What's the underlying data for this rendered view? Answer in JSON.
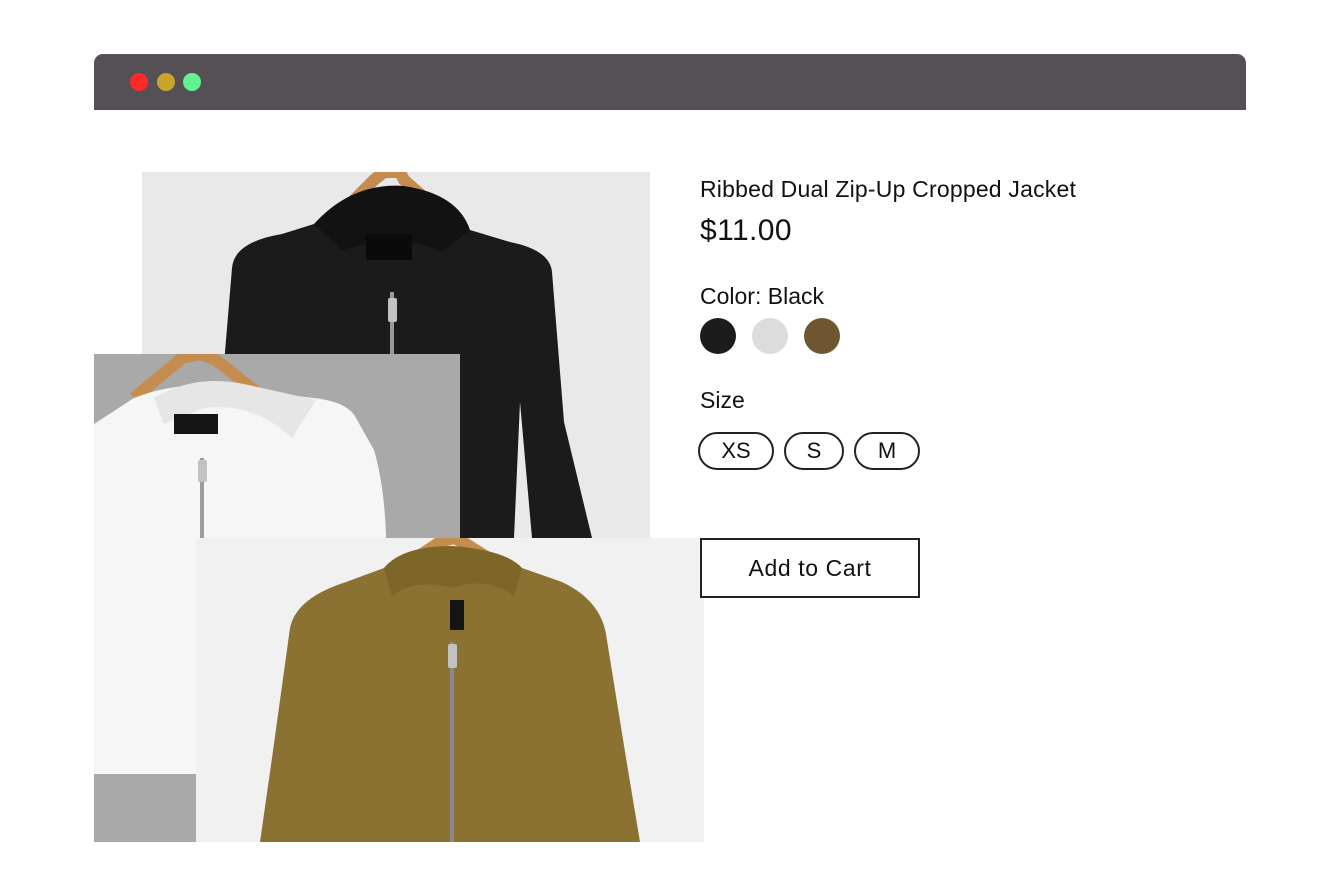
{
  "window": {
    "controls": [
      "close",
      "minimize",
      "maximize"
    ],
    "control_colors": {
      "close": "#fe2a2a",
      "minimize": "#c9a42c",
      "maximize": "#62f490"
    },
    "titlebar_color": "#555055"
  },
  "gallery": {
    "images": [
      {
        "name": "black-jacket-photo",
        "garment_color": "#1b1b1b",
        "background": "#e9e9ea"
      },
      {
        "name": "white-jacket-photo",
        "garment_color": "#f6f6f6",
        "background": "#a9a9a9"
      },
      {
        "name": "olive-jacket-photo",
        "garment_color": "#8c7232",
        "background": "#f1f1f1"
      }
    ]
  },
  "product": {
    "title": "Ribbed Dual Zip-Up Cropped Jacket",
    "price": "$11.00",
    "color_label": "Color: Black",
    "colors": [
      {
        "name": "Black",
        "hex": "#1c1c1c"
      },
      {
        "name": "Light Gray",
        "hex": "#dcdcdc"
      },
      {
        "name": "Brown",
        "hex": "#6f5630"
      }
    ],
    "size_label": "Size",
    "sizes": [
      "XS",
      "S",
      "M"
    ],
    "add_to_cart": "Add to Cart"
  }
}
